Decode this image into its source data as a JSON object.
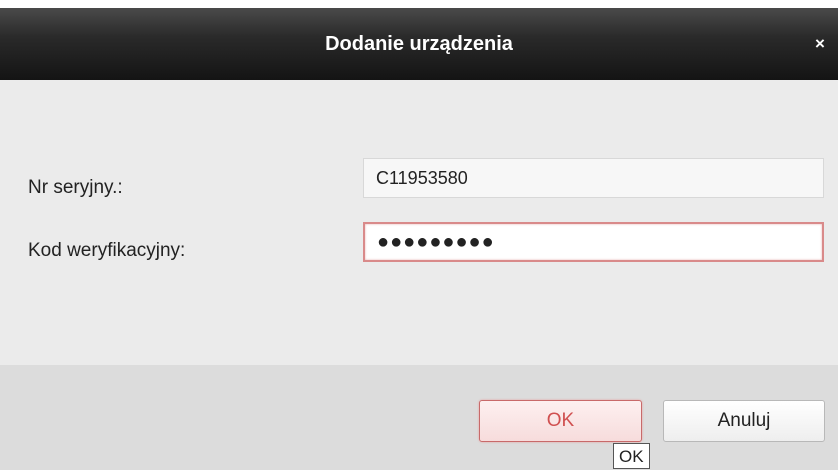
{
  "dialog": {
    "title": "Dodanie urządzenia",
    "close_glyph": "×"
  },
  "form": {
    "serial_label": "Nr seryjny.:",
    "serial_value": "C11953580",
    "code_label": "Kod weryfikacyjny:",
    "code_value_masked": "●●●●●●●●●"
  },
  "buttons": {
    "ok_label": "OK",
    "cancel_label": "Anuluj"
  },
  "tooltip": {
    "text": "OK"
  },
  "colors": {
    "titlebar": "#1a1a1a",
    "ok_accent": "#d05050",
    "field_error_border": "#d98a8a"
  }
}
